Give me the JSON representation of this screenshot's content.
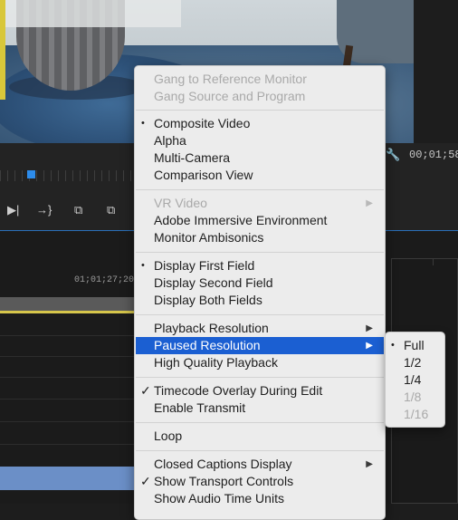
{
  "program_monitor": {
    "timecode": "00;01;58",
    "wrench_icon": "wrench-icon"
  },
  "transport": {
    "icons": [
      "step-forward-icon",
      "go-to-out-icon",
      "lift-icon",
      "extract-icon"
    ]
  },
  "timeline": {
    "ruler_timecode": "01;01;27;20"
  },
  "context_menu": {
    "items": [
      {
        "label": "Gang to Reference Monitor",
        "disabled": true
      },
      {
        "label": "Gang Source and Program",
        "disabled": true
      },
      {
        "label": "Composite Video",
        "mark": "•"
      },
      {
        "label": "Alpha"
      },
      {
        "label": "Multi-Camera"
      },
      {
        "label": "Comparison View"
      },
      {
        "label": "VR Video",
        "disabled": true,
        "submenu": true
      },
      {
        "label": "Adobe Immersive Environment"
      },
      {
        "label": "Monitor Ambisonics"
      },
      {
        "label": "Display First Field",
        "mark": "•"
      },
      {
        "label": "Display Second Field"
      },
      {
        "label": "Display Both Fields"
      },
      {
        "label": "Playback Resolution",
        "submenu": true
      },
      {
        "label": "Paused Resolution",
        "submenu": true,
        "highlighted": true
      },
      {
        "label": "High Quality Playback"
      },
      {
        "label": "Timecode Overlay During Edit",
        "mark": "✓"
      },
      {
        "label": "Enable Transmit"
      },
      {
        "label": "Loop"
      },
      {
        "label": "Closed Captions Display",
        "submenu": true
      },
      {
        "label": "Show Transport Controls",
        "mark": "✓"
      },
      {
        "label": "Show Audio Time Units"
      }
    ],
    "arrow_glyph": "▶"
  },
  "submenu": {
    "items": [
      {
        "label": "Full",
        "mark": "•"
      },
      {
        "label": "1/2"
      },
      {
        "label": "1/4"
      },
      {
        "label": "1/8",
        "disabled": true
      },
      {
        "label": "1/16",
        "disabled": true
      }
    ]
  },
  "colors": {
    "menu_bg": "#ececec",
    "highlight": "#1b5fd2",
    "disabled_text": "#a9a9a9"
  }
}
